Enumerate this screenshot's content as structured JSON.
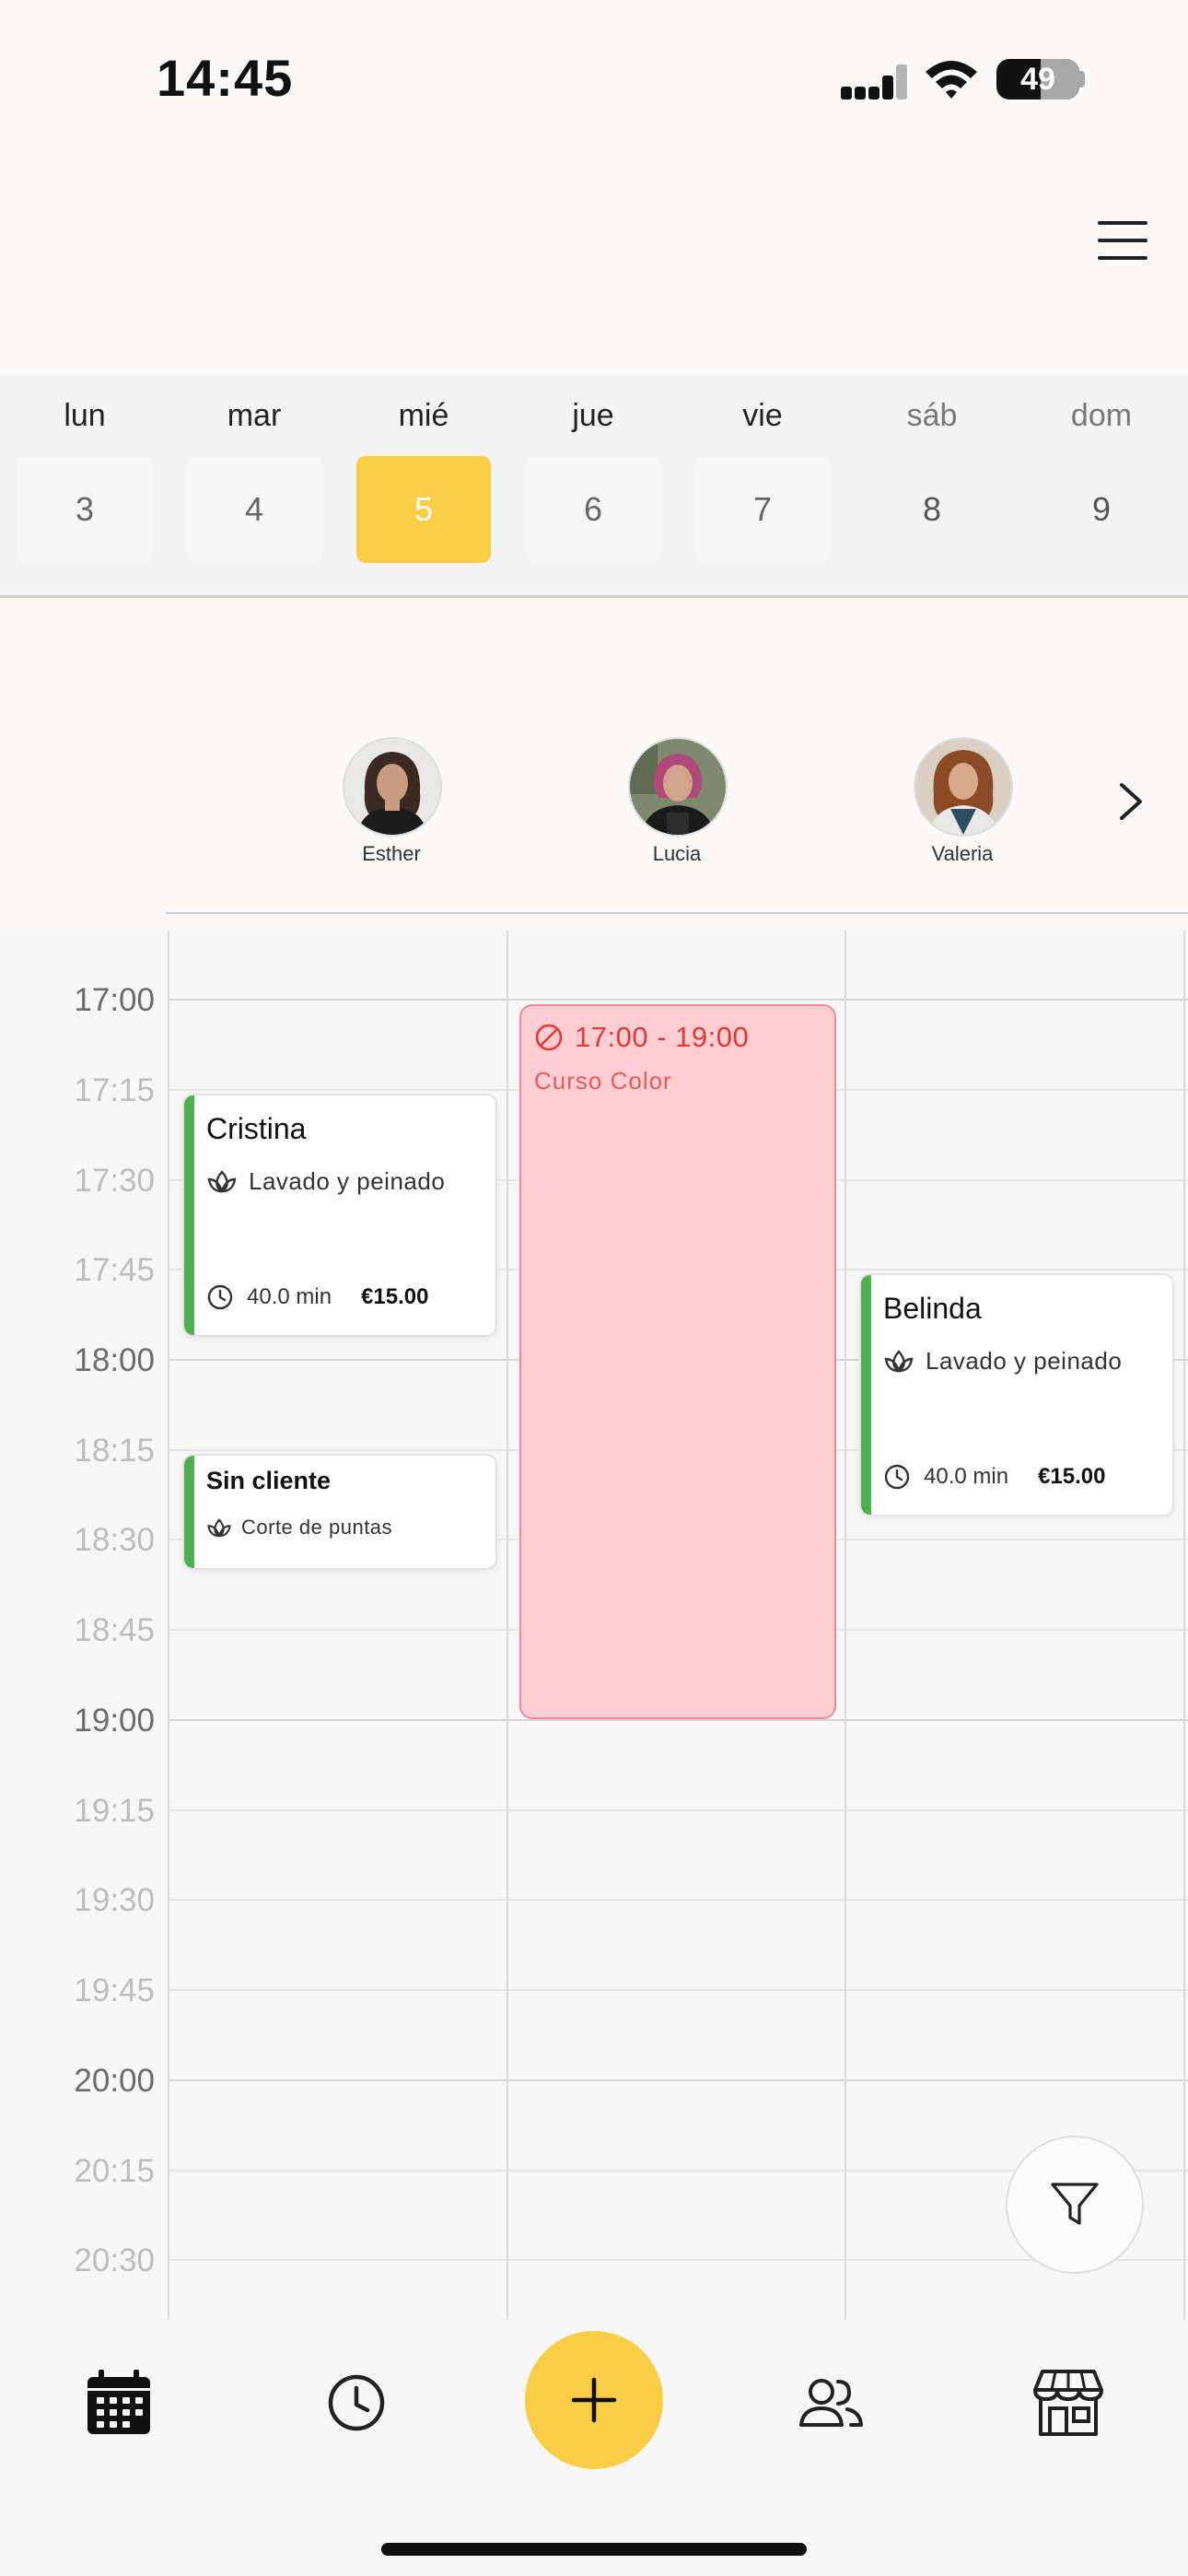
{
  "status_bar": {
    "time": "14:45",
    "battery": "49"
  },
  "header": {
    "menu_icon": "hamburger-menu-icon"
  },
  "week": {
    "days": [
      {
        "name": "lun",
        "num": "3"
      },
      {
        "name": "mar",
        "num": "4"
      },
      {
        "name": "mié",
        "num": "5"
      },
      {
        "name": "jue",
        "num": "6"
      },
      {
        "name": "vie",
        "num": "7"
      },
      {
        "name": "sáb",
        "num": "8"
      },
      {
        "name": "dom",
        "num": "9"
      }
    ],
    "selected": "5"
  },
  "staff": [
    {
      "name": "Esther"
    },
    {
      "name": "Lucia"
    },
    {
      "name": "Valeria"
    }
  ],
  "time_labels": [
    "17:00",
    "17:15",
    "17:30",
    "17:45",
    "18:00",
    "18:15",
    "18:30",
    "18:45",
    "19:00",
    "19:15",
    "19:30",
    "19:45",
    "20:00",
    "20:15",
    "20:30"
  ],
  "appointments": {
    "cristina": {
      "client": "Cristina",
      "service": "Lavado y peinado",
      "duration": "40.0 min",
      "price": "€15.00"
    },
    "sin_cliente": {
      "client": "Sin cliente",
      "service": "Corte de puntas"
    },
    "belinda": {
      "client": "Belinda",
      "service": "Lavado y peinado",
      "duration": "40.0 min",
      "price": "€15.00"
    }
  },
  "blocked": {
    "time": "17:00 - 19:00",
    "label": "Curso Color"
  },
  "colors": {
    "accent": "#f9cd45",
    "appointment_bar": "#4caf50",
    "blocked_bg": "#ffcdd2",
    "blocked_text": "#e53935"
  }
}
